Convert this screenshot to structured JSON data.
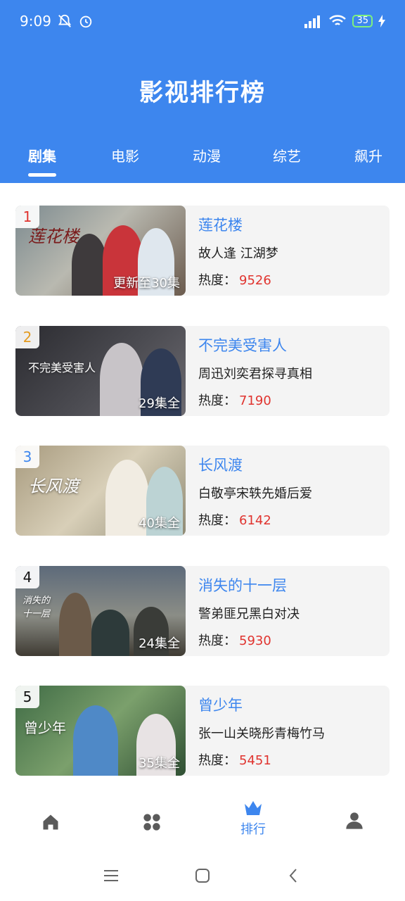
{
  "status": {
    "time": "9:09",
    "battery": "35"
  },
  "header": {
    "title": "影视排行榜"
  },
  "tabs": [
    {
      "label": "剧集"
    },
    {
      "label": "电影"
    },
    {
      "label": "动漫"
    },
    {
      "label": "综艺"
    },
    {
      "label": "飙升"
    }
  ],
  "list": [
    {
      "rank": "1",
      "title": "莲花楼",
      "desc": "故人逢 江湖梦",
      "heat_label": "热度：",
      "heat": "9526",
      "episodes": "更新至30集",
      "art_title": "莲花楼",
      "rank_color": "#e0342f"
    },
    {
      "rank": "2",
      "title": "不完美受害人",
      "desc": "周迅刘奕君探寻真相",
      "heat_label": "热度：",
      "heat": "7190",
      "episodes": "29集全",
      "art_title": "不完美受害人",
      "rank_color": "#e39a1f"
    },
    {
      "rank": "3",
      "title": "长风渡",
      "desc": "白敬亭宋轶先婚后爱",
      "heat_label": "热度：",
      "heat": "6142",
      "episodes": "40集全",
      "art_title": "长风渡",
      "rank_color": "#3d86ee"
    },
    {
      "rank": "4",
      "title": "消失的十一层",
      "desc": "警弟匪兄黑白对决",
      "heat_label": "热度：",
      "heat": "5930",
      "episodes": "24集全",
      "art_title": "消失的十一层",
      "rank_color": "#111111"
    },
    {
      "rank": "5",
      "title": "曾少年",
      "desc": "张一山关晓彤青梅竹马",
      "heat_label": "热度：",
      "heat": "5451",
      "episodes": "35集全",
      "art_title": "曾少年",
      "rank_color": "#111111"
    }
  ],
  "bottom_nav": {
    "rank_label": "排行"
  },
  "colors": {
    "primary": "#3d86ee",
    "heat": "#e0342f"
  }
}
